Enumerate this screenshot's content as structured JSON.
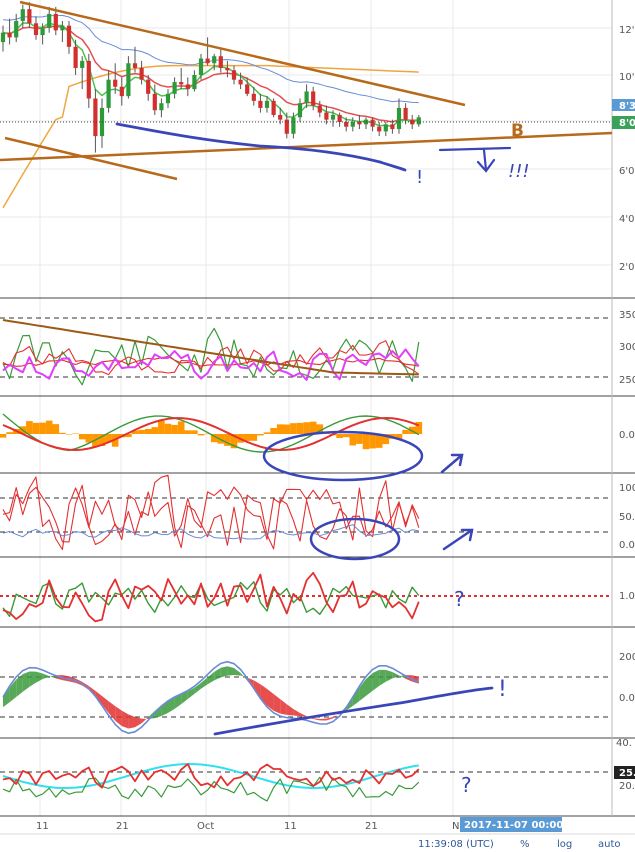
{
  "colors": {
    "up": "#2d9a3a",
    "down": "#d32f2f",
    "wick": "#555555",
    "ema_red": "#e35050",
    "ema_green": "#4cc34c",
    "ma_orange": "#f0a640",
    "ma_blue": "#6a8bd8",
    "trend_brown": "#b86a1c",
    "annotation_blue": "#3a46b8",
    "grid": "#e9e9e9",
    "separator": "#444444",
    "osc_green": "#3a9a3a",
    "osc_red": "#e33030",
    "osc_orange": "#ff9800",
    "osc_pink": "#e040fb",
    "osc_cyan": "#30e0f0",
    "osc_brown": "#9c5a16",
    "badge_blue": "#5b9bd5",
    "badge_green": "#3aa05a",
    "badge_dark": "#222222",
    "time_badge": "#5b9bd5"
  },
  "chart_data": [
    {
      "type": "candlestick",
      "pane": "price",
      "yticks": [
        "12'",
        "10'",
        "8'",
        "6'0",
        "4'0",
        "2'0"
      ],
      "last_price_labels": [
        "8'3",
        "8'0"
      ],
      "annotation_letter": "B",
      "annotation_text": [
        "!",
        "!!!"
      ],
      "ohlc": [
        [
          11.4,
          12.1,
          11.0,
          11.8
        ],
        [
          11.8,
          12.4,
          11.3,
          11.6
        ],
        [
          11.6,
          12.6,
          11.4,
          12.3
        ],
        [
          12.3,
          13.0,
          12.0,
          12.8
        ],
        [
          12.8,
          13.1,
          12.0,
          12.2
        ],
        [
          12.2,
          12.5,
          11.5,
          11.7
        ],
        [
          11.7,
          12.2,
          11.3,
          12.0
        ],
        [
          12.0,
          12.9,
          11.8,
          12.6
        ],
        [
          12.6,
          12.9,
          11.7,
          11.9
        ],
        [
          11.9,
          12.3,
          11.4,
          12.1
        ],
        [
          12.1,
          12.3,
          10.9,
          11.2
        ],
        [
          11.2,
          11.5,
          10.0,
          10.3
        ],
        [
          10.3,
          10.8,
          9.4,
          10.6
        ],
        [
          10.6,
          10.9,
          8.6,
          9.0
        ],
        [
          9.0,
          9.4,
          6.7,
          7.4
        ],
        [
          7.4,
          9.0,
          6.9,
          8.6
        ],
        [
          8.6,
          10.2,
          8.4,
          9.8
        ],
        [
          9.8,
          10.5,
          9.2,
          9.5
        ],
        [
          9.5,
          9.9,
          8.7,
          9.1
        ],
        [
          9.1,
          10.8,
          9.0,
          10.5
        ],
        [
          10.5,
          11.2,
          10.1,
          10.3
        ],
        [
          10.3,
          10.6,
          9.6,
          9.8
        ],
        [
          9.8,
          10.0,
          8.9,
          9.2
        ],
        [
          9.2,
          9.6,
          8.3,
          8.5
        ],
        [
          8.5,
          9.0,
          8.2,
          8.8
        ],
        [
          8.8,
          9.4,
          8.6,
          9.2
        ],
        [
          9.2,
          9.9,
          9.0,
          9.7
        ],
        [
          9.7,
          10.3,
          9.4,
          9.6
        ],
        [
          9.6,
          9.9,
          9.1,
          9.4
        ],
        [
          9.4,
          10.2,
          9.3,
          10.0
        ],
        [
          10.0,
          10.9,
          9.8,
          10.7
        ],
        [
          10.7,
          11.6,
          10.4,
          10.5
        ],
        [
          10.5,
          10.9,
          10.2,
          10.8
        ],
        [
          10.8,
          11.1,
          10.1,
          10.3
        ],
        [
          10.3,
          10.6,
          9.9,
          10.2
        ],
        [
          10.2,
          10.4,
          9.6,
          9.8
        ],
        [
          9.8,
          10.1,
          9.4,
          9.6
        ],
        [
          9.6,
          9.9,
          9.1,
          9.2
        ],
        [
          9.2,
          9.5,
          8.7,
          8.9
        ],
        [
          8.9,
          9.2,
          8.4,
          8.6
        ],
        [
          8.6,
          9.1,
          8.4,
          8.9
        ],
        [
          8.9,
          9.0,
          8.2,
          8.3
        ],
        [
          8.3,
          8.6,
          7.9,
          8.1
        ],
        [
          8.1,
          8.4,
          7.3,
          7.5
        ],
        [
          7.5,
          8.4,
          7.3,
          8.2
        ],
        [
          8.2,
          9.0,
          8.0,
          8.8
        ],
        [
          8.8,
          9.6,
          8.6,
          9.3
        ],
        [
          9.3,
          9.5,
          8.5,
          8.7
        ],
        [
          8.7,
          8.9,
          8.2,
          8.4
        ],
        [
          8.4,
          8.7,
          7.9,
          8.1
        ],
        [
          8.1,
          8.5,
          7.8,
          8.3
        ],
        [
          8.3,
          8.4,
          7.8,
          8.0
        ],
        [
          8.0,
          8.2,
          7.6,
          7.8
        ],
        [
          7.8,
          8.2,
          7.6,
          8.0
        ],
        [
          8.0,
          8.3,
          7.7,
          7.9
        ],
        [
          7.9,
          8.2,
          7.7,
          8.1
        ],
        [
          8.1,
          8.2,
          7.6,
          7.8
        ],
        [
          7.8,
          8.0,
          7.4,
          7.6
        ],
        [
          7.6,
          8.0,
          7.4,
          7.9
        ],
        [
          7.9,
          8.1,
          7.5,
          7.7
        ],
        [
          7.7,
          9.0,
          7.5,
          8.6
        ],
        [
          8.6,
          8.8,
          7.9,
          8.1
        ],
        [
          8.1,
          8.3,
          7.7,
          7.9
        ],
        [
          7.9,
          8.3,
          7.8,
          8.2
        ]
      ]
    },
    {
      "type": "line",
      "pane": "oscillator-1",
      "yticks": [
        "350",
        "300",
        "250"
      ]
    },
    {
      "type": "area",
      "pane": "oscillator-2",
      "yticks": [
        "0.0"
      ]
    },
    {
      "type": "line",
      "pane": "oscillator-3",
      "yticks": [
        "100",
        "50.",
        "0.0"
      ]
    },
    {
      "type": "line",
      "pane": "oscillator-4",
      "yticks": [
        "1.0"
      ],
      "annotation_text": [
        "?"
      ]
    },
    {
      "type": "area",
      "pane": "oscillator-5",
      "yticks": [
        "200",
        "0.0"
      ],
      "annotation_text": [
        "!"
      ]
    },
    {
      "type": "line",
      "pane": "oscillator-6",
      "yticks": [
        "40.",
        "20."
      ],
      "last_value_label": "25.",
      "annotation_text": [
        "?"
      ]
    }
  ],
  "x_axis": {
    "ticks": [
      "11",
      "21",
      "Oct",
      "11",
      "21",
      "N"
    ]
  },
  "crosshair_time": "2017-11-07 00:00:00",
  "status_bar": {
    "clock": "11:39:08 (UTC)",
    "percent": "%",
    "log": "log",
    "auto": "auto"
  }
}
